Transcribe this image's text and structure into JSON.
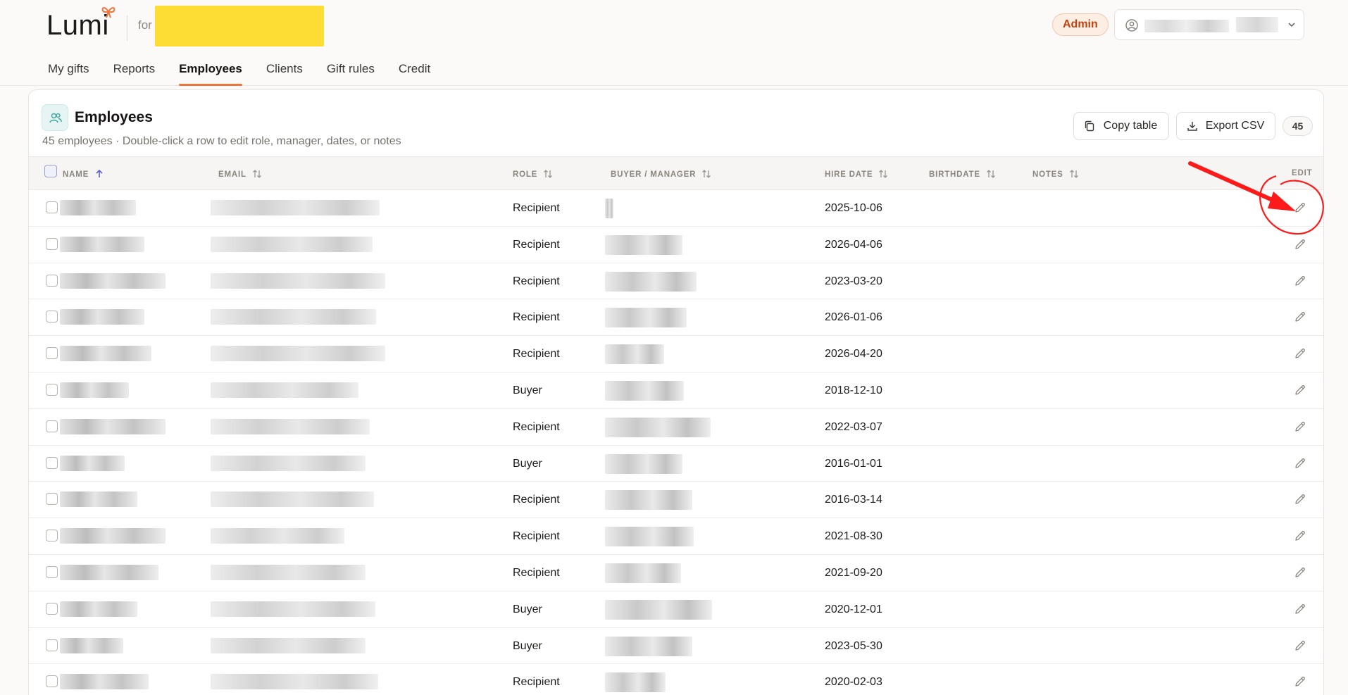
{
  "header": {
    "logo_text": "Lumi",
    "for_label": "for",
    "admin_badge": "Admin"
  },
  "nav": {
    "tabs": [
      {
        "label": "My gifts",
        "active": false
      },
      {
        "label": "Reports",
        "active": false
      },
      {
        "label": "Employees",
        "active": true
      },
      {
        "label": "Clients",
        "active": false
      },
      {
        "label": "Gift rules",
        "active": false
      },
      {
        "label": "Credit",
        "active": false
      }
    ]
  },
  "card": {
    "title": "Employees",
    "subtitle": "45 employees · Double-click a row to edit role, manager, dates, or notes",
    "copy_button": "Copy table",
    "export_button": "Export CSV",
    "count": "45"
  },
  "table": {
    "columns": {
      "name": "NAME",
      "email": "EMAIL",
      "role": "ROLE",
      "manager": "BUYER / MANAGER",
      "hire_date": "HIRE DATE",
      "birthdate": "BIRTHDATE",
      "notes": "NOTES",
      "edit": "EDIT"
    },
    "rows": [
      {
        "role": "Recipient",
        "hire_date": "2025-10-06"
      },
      {
        "role": "Recipient",
        "hire_date": "2026-04-06"
      },
      {
        "role": "Recipient",
        "hire_date": "2023-03-20"
      },
      {
        "role": "Recipient",
        "hire_date": "2026-01-06"
      },
      {
        "role": "Recipient",
        "hire_date": "2026-04-20"
      },
      {
        "role": "Buyer",
        "hire_date": "2018-12-10"
      },
      {
        "role": "Recipient",
        "hire_date": "2022-03-07"
      },
      {
        "role": "Buyer",
        "hire_date": "2016-01-01"
      },
      {
        "role": "Recipient",
        "hire_date": "2016-03-14"
      },
      {
        "role": "Recipient",
        "hire_date": "2021-08-30"
      },
      {
        "role": "Recipient",
        "hire_date": "2021-09-20"
      },
      {
        "role": "Buyer",
        "hire_date": "2020-12-01"
      },
      {
        "role": "Buyer",
        "hire_date": "2023-05-30"
      },
      {
        "role": "Recipient",
        "hire_date": "2020-02-03"
      }
    ]
  },
  "colors": {
    "accent": "#f2733b",
    "admin_text": "#c2410c",
    "annotation": "#ff1a1a"
  }
}
